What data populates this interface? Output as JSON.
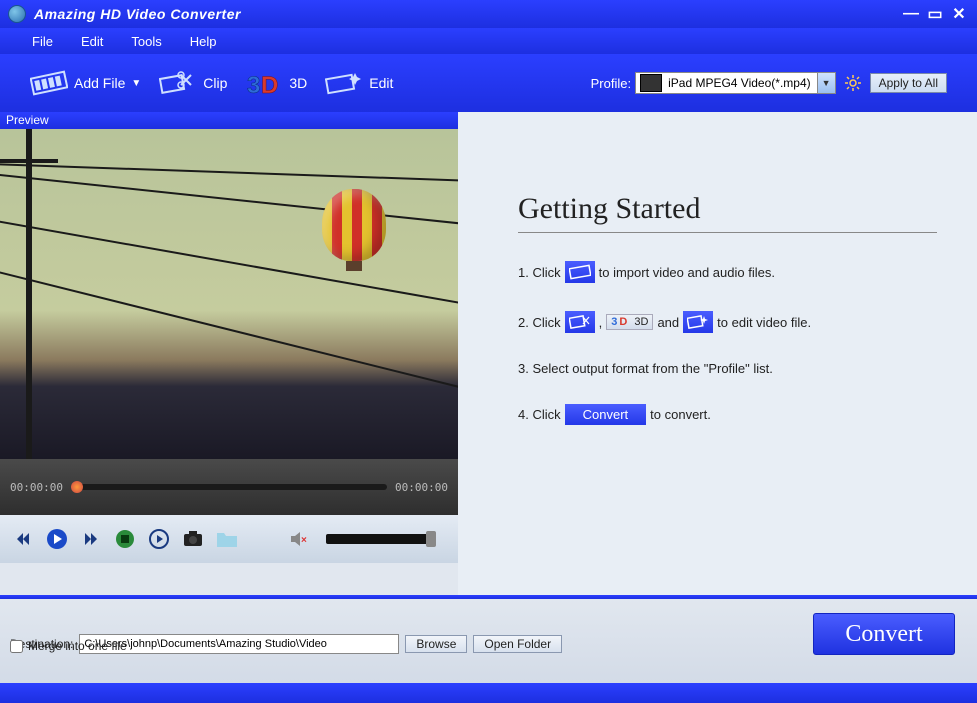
{
  "title": "Amazing HD Video Converter",
  "menu": {
    "file": "File",
    "edit": "Edit",
    "tools": "Tools",
    "help": "Help"
  },
  "toolbar": {
    "addfile": "Add File",
    "clip": "Clip",
    "threed": "3D",
    "edit": "Edit",
    "profile_label": "Profile:",
    "profile_value": "iPad MPEG4 Video(*.mp4)",
    "apply_all": "Apply to All"
  },
  "preview": {
    "label": "Preview",
    "time_start": "00:00:00",
    "time_end": "00:00:00"
  },
  "getting_started": {
    "title": "Getting Started",
    "s1a": "1. Click",
    "s1b": "to import video and audio files.",
    "s2a": "2. Click",
    "s2comma": ",",
    "s2_3d": "3D",
    "s2and": "and",
    "s2b": "to edit video file.",
    "s3": "3. Select output format from the \"Profile\" list.",
    "s4a": "4. Click",
    "s4_convert": "Convert",
    "s4b": "to convert."
  },
  "bottom": {
    "destination_label": "Destination:",
    "destination_value": "C:\\Users\\johnp\\Documents\\Amazing Studio\\Video",
    "browse": "Browse",
    "open_folder": "Open Folder",
    "merge": "Merge into one file",
    "convert": "Convert"
  }
}
